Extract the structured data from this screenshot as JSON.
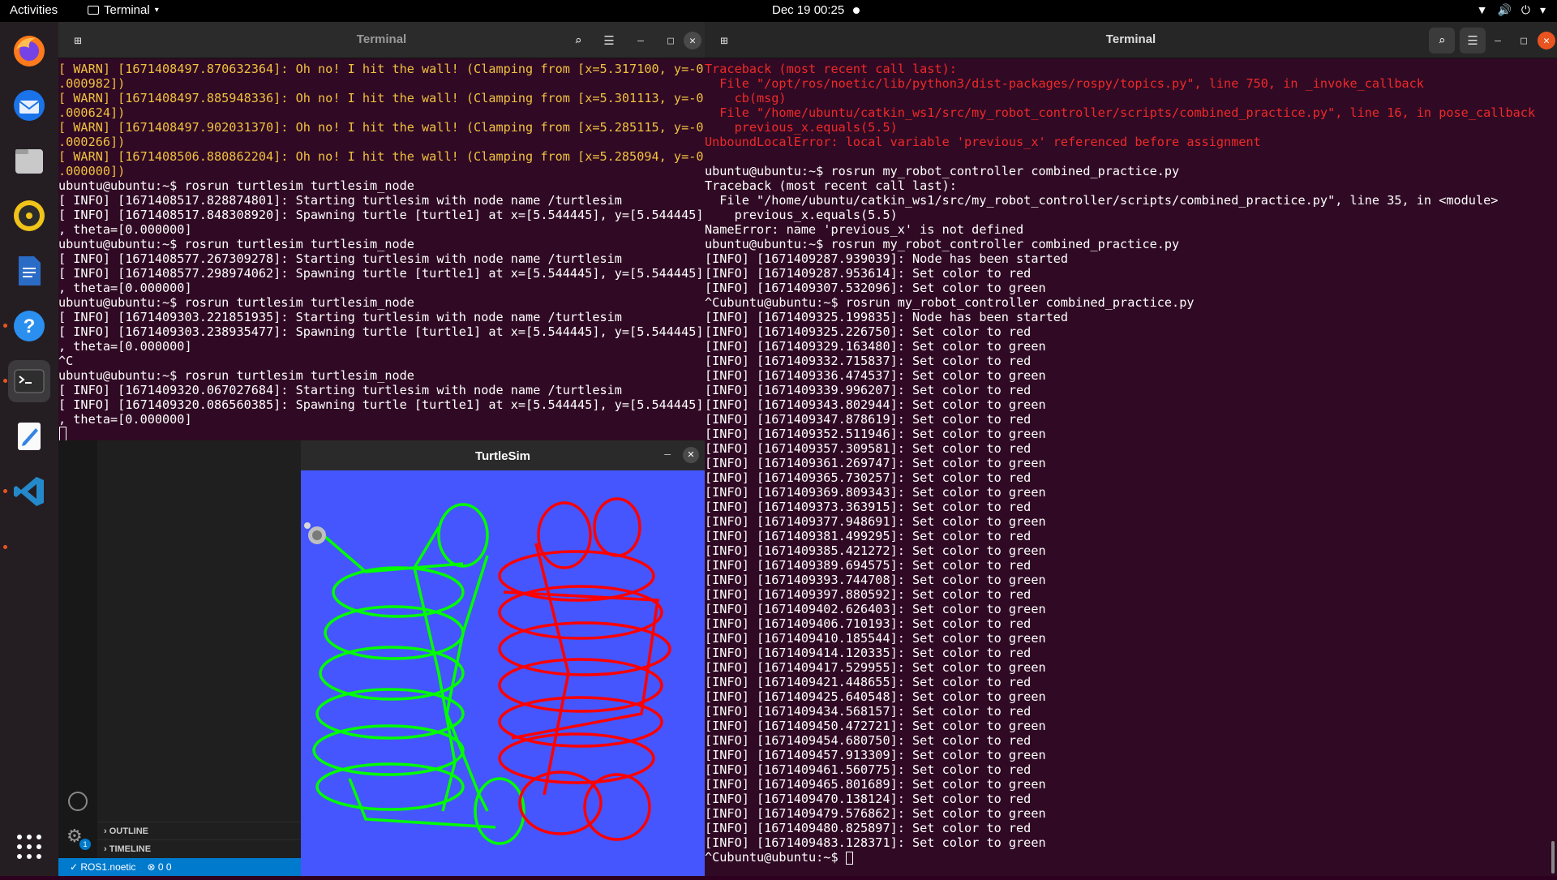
{
  "topbar": {
    "activities": "Activities",
    "app_name": "Terminal",
    "clock": "Dec 19  00:25"
  },
  "dock": {
    "items": [
      {
        "name": "firefox-icon"
      },
      {
        "name": "thunderbird-icon"
      },
      {
        "name": "files-icon"
      },
      {
        "name": "rhythmbox-icon"
      },
      {
        "name": "libreoffice-writer-icon"
      },
      {
        "name": "help-icon"
      },
      {
        "name": "terminal-icon"
      },
      {
        "name": "text-editor-icon"
      },
      {
        "name": "vscode-icon"
      },
      {
        "name": "show-apps-icon"
      }
    ]
  },
  "left_terminal": {
    "title": "Terminal",
    "lines": [
      {
        "t": "[ WARN] [1671408497.870632364]: Oh no! I hit the wall! (Clamping from [x=5.317100, y=-0",
        "c": "warn"
      },
      {
        "t": ".000982])",
        "c": "warn"
      },
      {
        "t": "[ WARN] [1671408497.885948336]: Oh no! I hit the wall! (Clamping from [x=5.301113, y=-0",
        "c": "warn"
      },
      {
        "t": ".000624])",
        "c": "warn"
      },
      {
        "t": "[ WARN] [1671408497.902031370]: Oh no! I hit the wall! (Clamping from [x=5.285115, y=-0",
        "c": "warn"
      },
      {
        "t": ".000266])",
        "c": "warn"
      },
      {
        "t": "[ WARN] [1671408506.880862204]: Oh no! I hit the wall! (Clamping from [x=5.285094, y=-0",
        "c": "warn"
      },
      {
        "t": ".000000])",
        "c": "warn"
      },
      {
        "t": "ubuntu@ubuntu:~$ rosrun turtlesim turtlesim_node",
        "c": ""
      },
      {
        "t": "[ INFO] [1671408517.828874801]: Starting turtlesim with node name /turtlesim",
        "c": ""
      },
      {
        "t": "[ INFO] [1671408517.848308920]: Spawning turtle [turtle1] at x=[5.544445], y=[5.544445]",
        "c": ""
      },
      {
        "t": ", theta=[0.000000]",
        "c": ""
      },
      {
        "t": "ubuntu@ubuntu:~$ rosrun turtlesim turtlesim_node",
        "c": ""
      },
      {
        "t": "[ INFO] [1671408577.267309278]: Starting turtlesim with node name /turtlesim",
        "c": ""
      },
      {
        "t": "[ INFO] [1671408577.298974062]: Spawning turtle [turtle1] at x=[5.544445], y=[5.544445]",
        "c": ""
      },
      {
        "t": ", theta=[0.000000]",
        "c": ""
      },
      {
        "t": "ubuntu@ubuntu:~$ rosrun turtlesim turtlesim_node",
        "c": ""
      },
      {
        "t": "[ INFO] [1671409303.221851935]: Starting turtlesim with node name /turtlesim",
        "c": ""
      },
      {
        "t": "[ INFO] [1671409303.238935477]: Spawning turtle [turtle1] at x=[5.544445], y=[5.544445]",
        "c": ""
      },
      {
        "t": ", theta=[0.000000]",
        "c": ""
      },
      {
        "t": "^C",
        "c": ""
      },
      {
        "t": "ubuntu@ubuntu:~$ rosrun turtlesim turtlesim_node",
        "c": ""
      },
      {
        "t": "[ INFO] [1671409320.067027684]: Starting turtlesim with node name /turtlesim",
        "c": ""
      },
      {
        "t": "[ INFO] [1671409320.086560385]: Spawning turtle [turtle1] at x=[5.544445], y=[5.544445]",
        "c": ""
      },
      {
        "t": ", theta=[0.000000]",
        "c": ""
      }
    ]
  },
  "right_terminal": {
    "title": "Terminal",
    "lines": [
      {
        "t": "Traceback (most recent call last):",
        "c": "err"
      },
      {
        "t": "  File \"/opt/ros/noetic/lib/python3/dist-packages/rospy/topics.py\", line 750, in _invoke_callback",
        "c": "err"
      },
      {
        "t": "    cb(msg)",
        "c": "err"
      },
      {
        "t": "  File \"/home/ubuntu/catkin_ws1/src/my_robot_controller/scripts/combined_practice.py\", line 16, in pose_callback",
        "c": "err"
      },
      {
        "t": "    previous_x.equals(5.5)",
        "c": "err"
      },
      {
        "t": "UnboundLocalError: local variable 'previous_x' referenced before assignment",
        "c": "err"
      },
      {
        "t": "",
        "c": ""
      },
      {
        "t": "ubuntu@ubuntu:~$ rosrun my_robot_controller combined_practice.py",
        "c": ""
      },
      {
        "t": "Traceback (most recent call last):",
        "c": ""
      },
      {
        "t": "  File \"/home/ubuntu/catkin_ws1/src/my_robot_controller/scripts/combined_practice.py\", line 35, in <module>",
        "c": ""
      },
      {
        "t": "    previous_x.equals(5.5)",
        "c": ""
      },
      {
        "t": "NameError: name 'previous_x' is not defined",
        "c": ""
      },
      {
        "t": "ubuntu@ubuntu:~$ rosrun my_robot_controller combined_practice.py",
        "c": ""
      },
      {
        "t": "[INFO] [1671409287.939039]: Node has been started",
        "c": ""
      },
      {
        "t": "[INFO] [1671409287.953614]: Set color to red",
        "c": ""
      },
      {
        "t": "[INFO] [1671409307.532096]: Set color to green",
        "c": ""
      },
      {
        "t": "^Cubuntu@ubuntu:~$ rosrun my_robot_controller combined_practice.py",
        "c": ""
      },
      {
        "t": "[INFO] [1671409325.199835]: Node has been started",
        "c": ""
      },
      {
        "t": "[INFO] [1671409325.226750]: Set color to red",
        "c": ""
      },
      {
        "t": "[INFO] [1671409329.163480]: Set color to green",
        "c": ""
      },
      {
        "t": "[INFO] [1671409332.715837]: Set color to red",
        "c": ""
      },
      {
        "t": "[INFO] [1671409336.474537]: Set color to green",
        "c": ""
      },
      {
        "t": "[INFO] [1671409339.996207]: Set color to red",
        "c": ""
      },
      {
        "t": "[INFO] [1671409343.802944]: Set color to green",
        "c": ""
      },
      {
        "t": "[INFO] [1671409347.878619]: Set color to red",
        "c": ""
      },
      {
        "t": "[INFO] [1671409352.511946]: Set color to green",
        "c": ""
      },
      {
        "t": "[INFO] [1671409357.309581]: Set color to red",
        "c": ""
      },
      {
        "t": "[INFO] [1671409361.269747]: Set color to green",
        "c": ""
      },
      {
        "t": "[INFO] [1671409365.730257]: Set color to red",
        "c": ""
      },
      {
        "t": "[INFO] [1671409369.809343]: Set color to green",
        "c": ""
      },
      {
        "t": "[INFO] [1671409373.363915]: Set color to red",
        "c": ""
      },
      {
        "t": "[INFO] [1671409377.948691]: Set color to green",
        "c": ""
      },
      {
        "t": "[INFO] [1671409381.499295]: Set color to red",
        "c": ""
      },
      {
        "t": "[INFO] [1671409385.421272]: Set color to green",
        "c": ""
      },
      {
        "t": "[INFO] [1671409389.694575]: Set color to red",
        "c": ""
      },
      {
        "t": "[INFO] [1671409393.744708]: Set color to green",
        "c": ""
      },
      {
        "t": "[INFO] [1671409397.880592]: Set color to red",
        "c": ""
      },
      {
        "t": "[INFO] [1671409402.626403]: Set color to green",
        "c": ""
      },
      {
        "t": "[INFO] [1671409406.710193]: Set color to red",
        "c": ""
      },
      {
        "t": "[INFO] [1671409410.185544]: Set color to green",
        "c": ""
      },
      {
        "t": "[INFO] [1671409414.120335]: Set color to red",
        "c": ""
      },
      {
        "t": "[INFO] [1671409417.529955]: Set color to green",
        "c": ""
      },
      {
        "t": "[INFO] [1671409421.448655]: Set color to red",
        "c": ""
      },
      {
        "t": "[INFO] [1671409425.640548]: Set color to green",
        "c": ""
      },
      {
        "t": "[INFO] [1671409434.568157]: Set color to red",
        "c": ""
      },
      {
        "t": "[INFO] [1671409450.472721]: Set color to green",
        "c": ""
      },
      {
        "t": "[INFO] [1671409454.680750]: Set color to red",
        "c": ""
      },
      {
        "t": "[INFO] [1671409457.913309]: Set color to green",
        "c": ""
      },
      {
        "t": "[INFO] [1671409461.560775]: Set color to red",
        "c": ""
      },
      {
        "t": "[INFO] [1671409465.801689]: Set color to green",
        "c": ""
      },
      {
        "t": "[INFO] [1671409470.138124]: Set color to red",
        "c": ""
      },
      {
        "t": "[INFO] [1671409479.576862]: Set color to green",
        "c": ""
      },
      {
        "t": "[INFO] [1671409480.825897]: Set color to red",
        "c": ""
      },
      {
        "t": "[INFO] [1671409483.128371]: Set color to green",
        "c": ""
      },
      {
        "t": "^Cubuntu@ubuntu:~$ ",
        "c": ""
      }
    ]
  },
  "vscode": {
    "outline": "OUTLINE",
    "timeline": "TIMELINE",
    "status_env": "ROS1.noetic",
    "status_problems": "0  0",
    "notification_count": "1"
  },
  "turtlesim": {
    "title": "TurtleSim",
    "background_color": "#4556ff",
    "pen_colors": {
      "green": "#00ff00",
      "red": "#ff0000"
    }
  },
  "colors": {
    "terminal_bg": "#300a24",
    "warn": "#f0c040",
    "error": "#ef2929",
    "accent": "#e95420"
  }
}
